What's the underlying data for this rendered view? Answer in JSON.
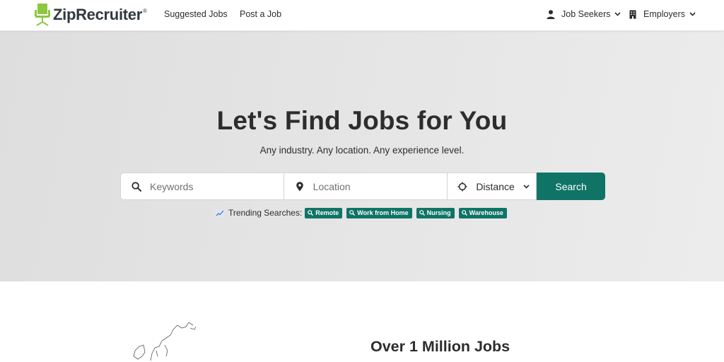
{
  "header": {
    "logo_text": "ZipRecruiter",
    "logo_mark": "®",
    "nav": [
      {
        "label": "Suggested Jobs"
      },
      {
        "label": "Post a Job"
      }
    ],
    "job_seekers_label": "Job Seekers",
    "employers_label": "Employers"
  },
  "hero": {
    "title": "Let's Find Jobs for You",
    "subtitle": "Any industry. Any location. Any experience level.",
    "search": {
      "keywords_placeholder": "Keywords",
      "location_placeholder": "Location",
      "distance_label": "Distance",
      "button_label": "Search"
    },
    "trending": {
      "label": "Trending Searches:",
      "chips": [
        "Remote",
        "Work from Home",
        "Nursing",
        "Warehouse"
      ]
    }
  },
  "lower": {
    "title": "Over 1 Million Jobs"
  },
  "colors": {
    "brand_green": "#0f7466",
    "logo_lime": "#8dc63f",
    "text_dark": "#2d2d2d"
  },
  "icons": [
    "ziprecruiter-chair-logo",
    "user-icon",
    "building-icon",
    "chevron-down-icon",
    "search-icon",
    "location-pin-icon",
    "crosshair-icon",
    "trending-chart-icon"
  ]
}
